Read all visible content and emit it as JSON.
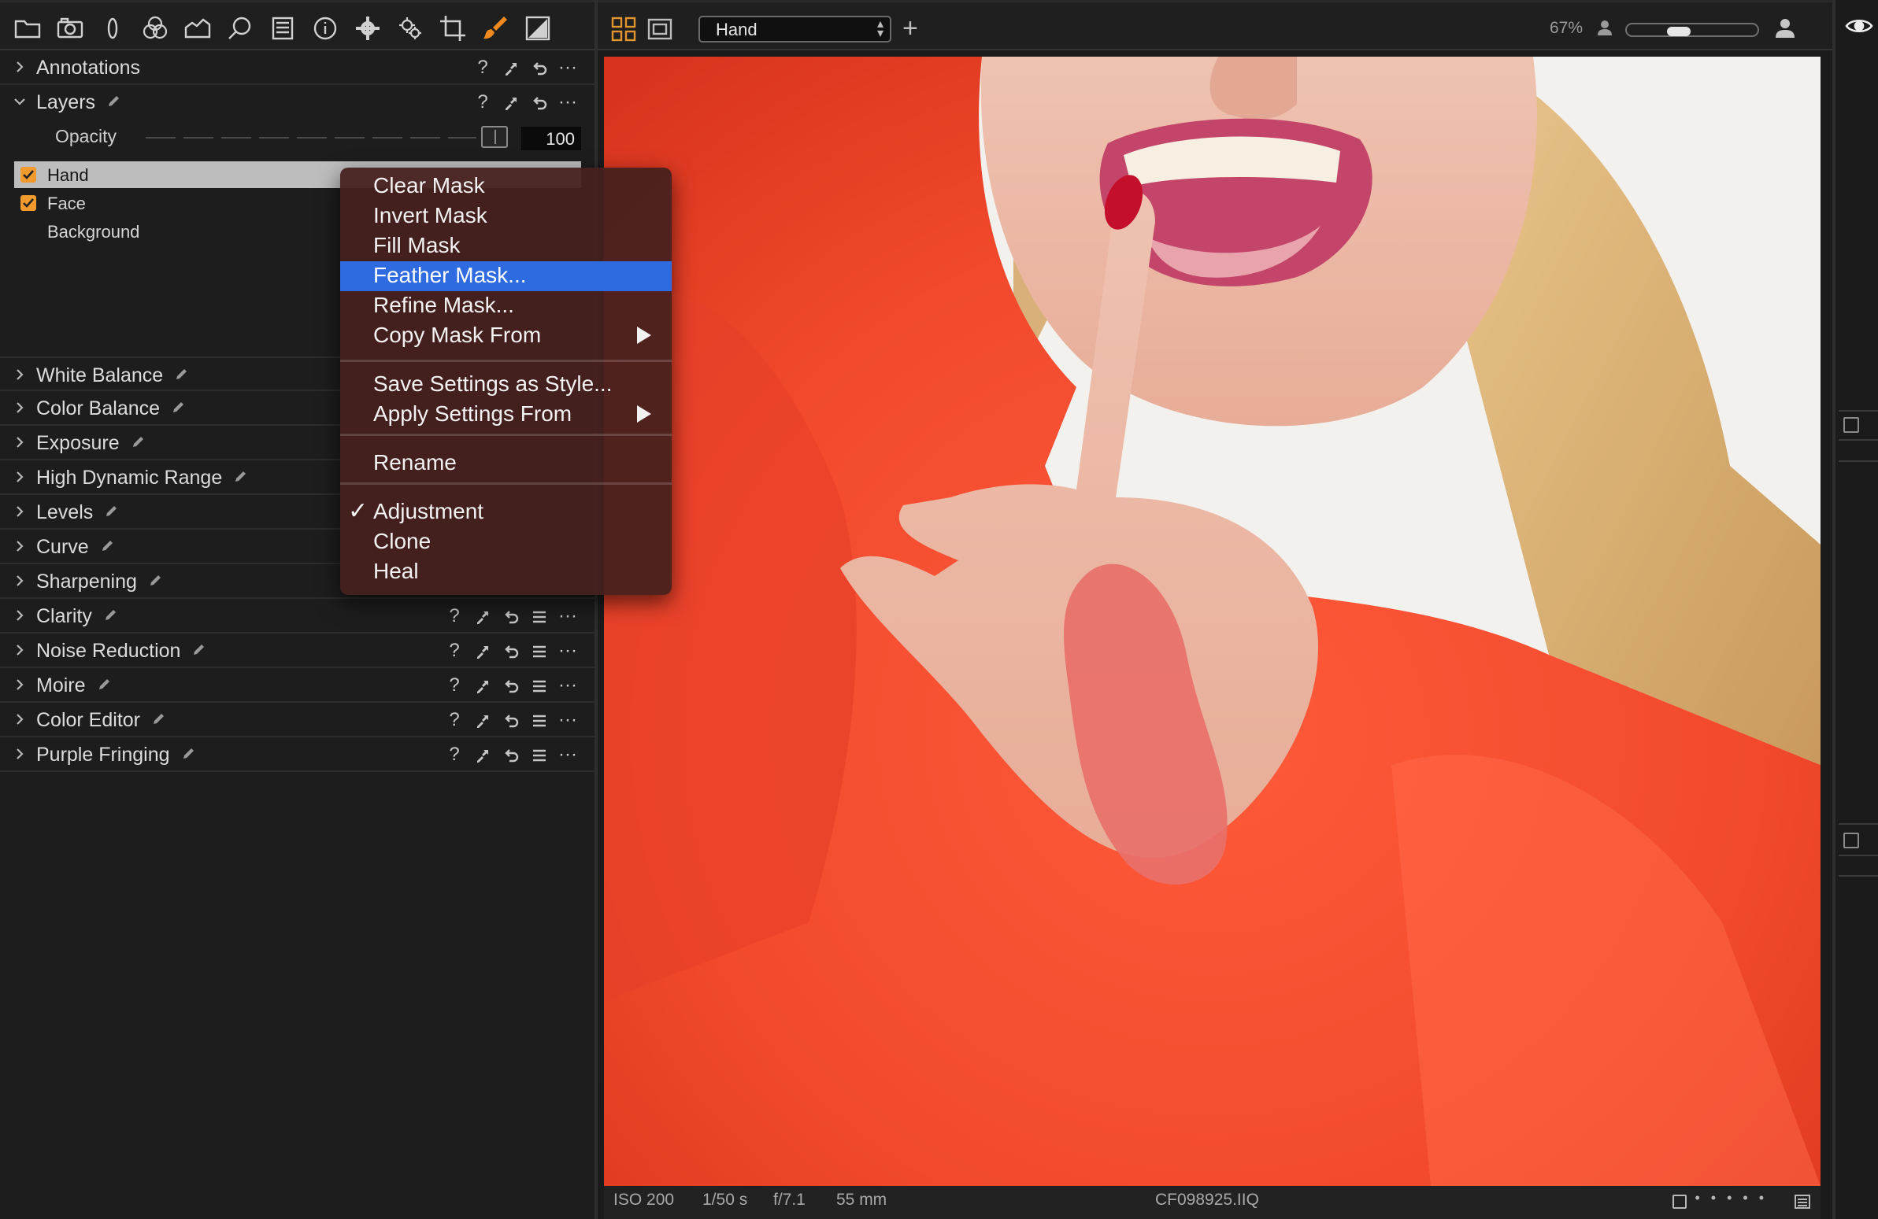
{
  "tool_tabs": [
    "library-icon",
    "capture-icon",
    "lens-icon",
    "color-icon",
    "exposure-icon",
    "focus-icon",
    "metadata-icon",
    "info-icon",
    "settings-icon",
    "batch-icon",
    "crop-icon",
    "local-adjustments-icon",
    "color-swatch-icon"
  ],
  "panel": {
    "annotations": {
      "title": "Annotations"
    },
    "layers": {
      "title": "Layers",
      "opacity_label": "Opacity",
      "opacity_value": "100",
      "items": [
        {
          "name": "Hand",
          "checked": true,
          "selected": true
        },
        {
          "name": "Face",
          "checked": true,
          "selected": false
        },
        {
          "name": "Background",
          "checked": false,
          "selected": false
        }
      ]
    },
    "sections": [
      {
        "title": "White Balance"
      },
      {
        "title": "Color Balance"
      },
      {
        "title": "Exposure"
      },
      {
        "title": "High Dynamic Range"
      },
      {
        "title": "Levels"
      },
      {
        "title": "Curve"
      },
      {
        "title": "Sharpening"
      },
      {
        "title": "Clarity"
      },
      {
        "title": "Noise Reduction"
      },
      {
        "title": "Moire"
      },
      {
        "title": "Color Editor"
      },
      {
        "title": "Purple Fringing"
      }
    ],
    "tool_help": "?",
    "tool_more": "···"
  },
  "viewer": {
    "layer_select": "Hand",
    "zoom": "67%",
    "zoom_level": 0.35
  },
  "context_menu": {
    "items": [
      {
        "label": "Clear Mask"
      },
      {
        "label": "Invert Mask"
      },
      {
        "label": "Fill Mask"
      },
      {
        "label": "Feather Mask..."
      },
      {
        "label": "Refine Mask..."
      },
      {
        "label": "Copy Mask From"
      },
      {
        "label": "Save Settings as Style..."
      },
      {
        "label": "Apply Settings From"
      },
      {
        "label": "Rename"
      },
      {
        "label": "Adjustment"
      },
      {
        "label": "Clone"
      },
      {
        "label": "Heal"
      }
    ],
    "checkmark": "✓"
  },
  "status_bar": {
    "iso": "ISO 200",
    "shutter": "1/50 s",
    "aperture": "f/7.1",
    "focal_length": "55 mm",
    "filename": "CF098925.IIQ",
    "dots": "•••••"
  },
  "colors": {
    "accent_orange": "#f08a1e",
    "menu_highlight": "#2f6be0",
    "mask_overlay": "#e8706a"
  }
}
